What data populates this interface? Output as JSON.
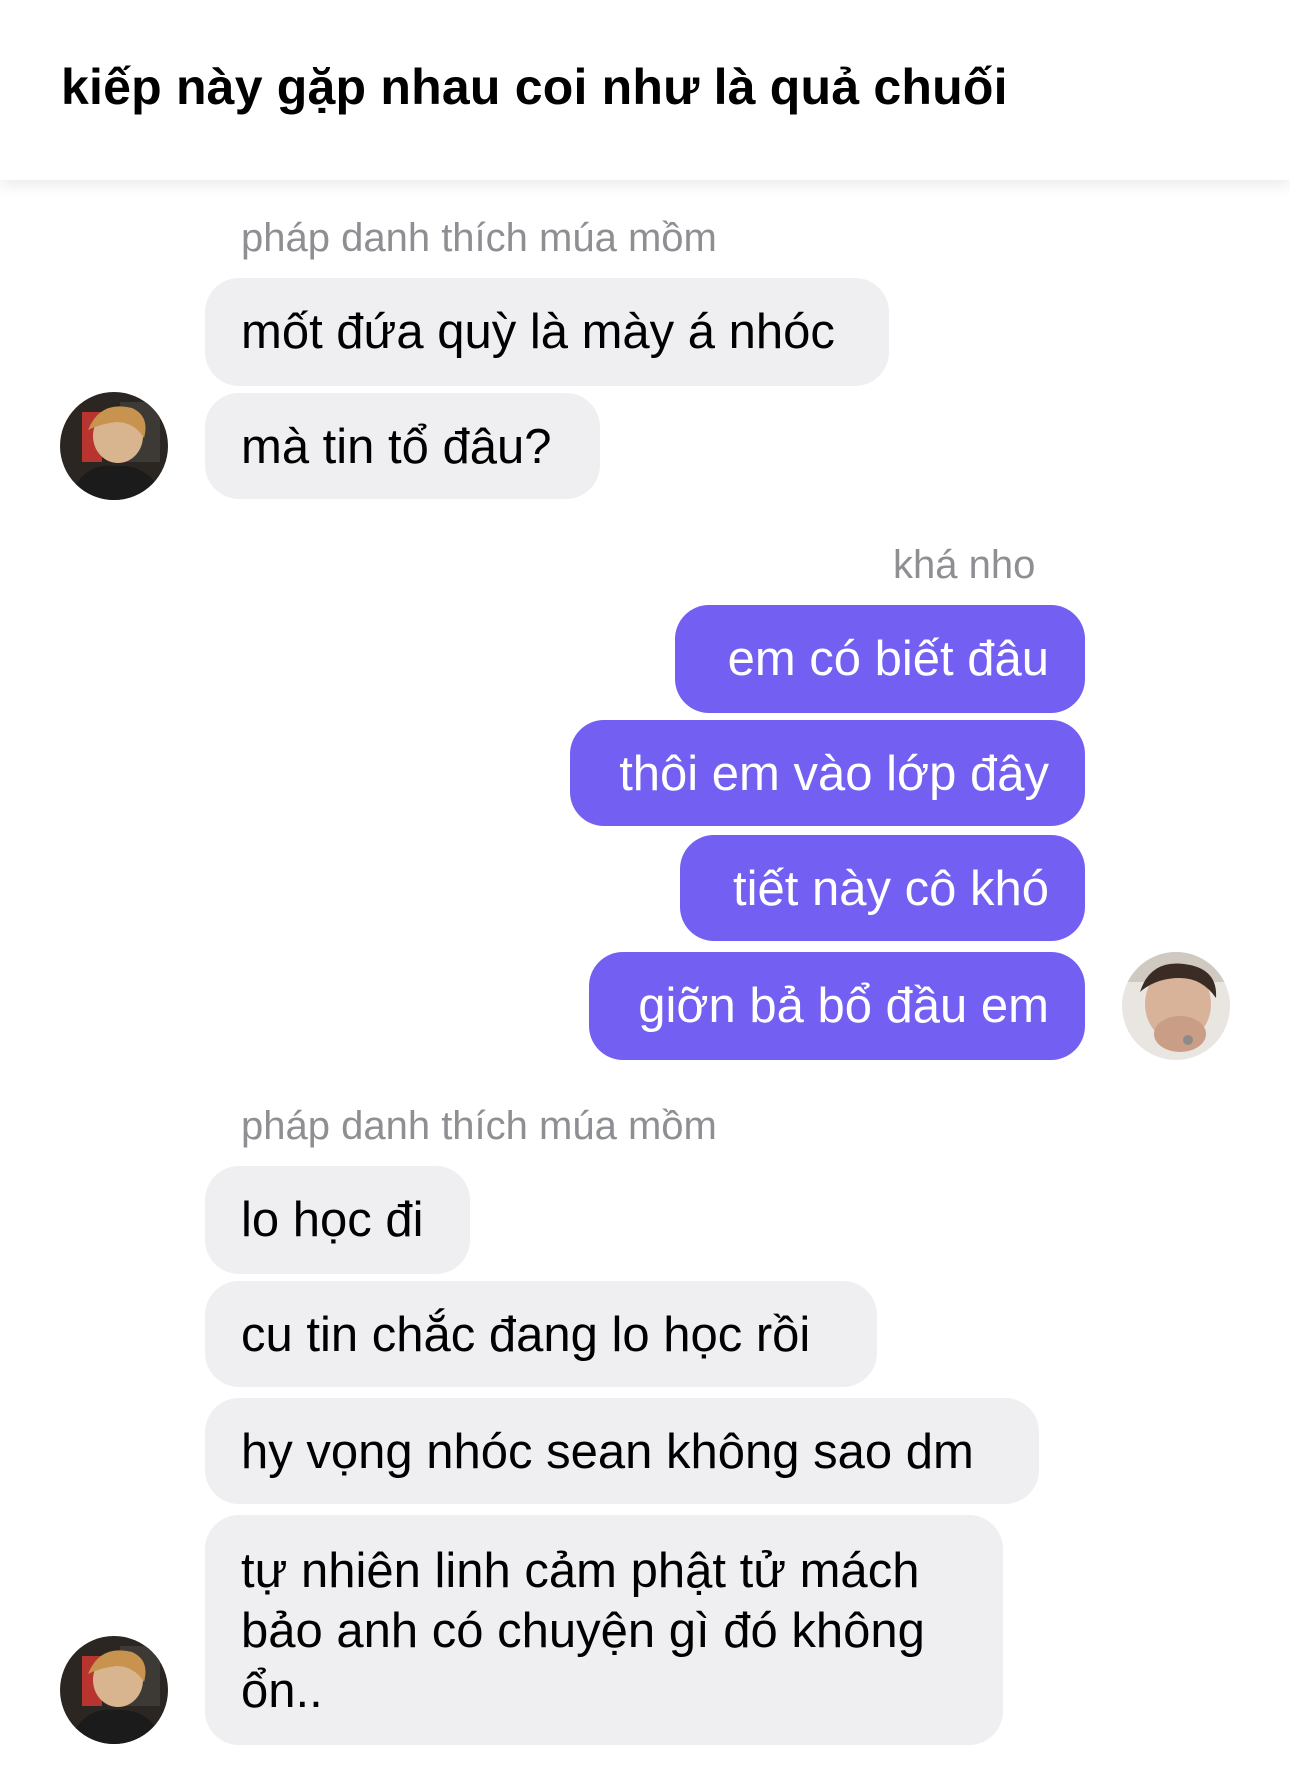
{
  "header": {
    "title": "kiếp này gặp nhau coi như là quả chuối"
  },
  "messages": {
    "group1": {
      "sender": "pháp danh thích múa mồm",
      "texts": [
        "mốt đứa quỳ là mày á nhóc",
        "mà tin tổ đâu?"
      ]
    },
    "group2": {
      "sender": "khá nho",
      "texts": [
        "em có biết đâu",
        "thôi em vào lớp đây",
        "tiết này cô khó",
        "giỡn bả bổ đầu em"
      ]
    },
    "group3": {
      "sender": "pháp danh thích múa mồm",
      "texts": [
        "lo học đi",
        "cu tin chắc đang lo học rồi",
        "hy vọng nhóc sean không sao dm",
        "tự nhiên linh cảm phật tử mách bảo anh có chuyện gì đó không ổn.."
      ]
    }
  },
  "colors": {
    "outgoing_bubble": "#7360f2",
    "incoming_bubble": "#efeff1",
    "sender_name": "#8e8e93"
  }
}
